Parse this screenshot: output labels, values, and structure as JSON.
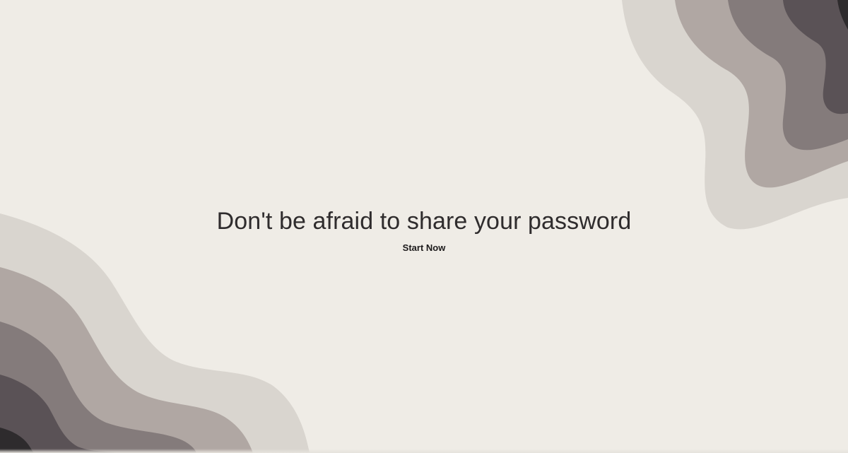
{
  "hero": {
    "headline": "Don't be afraid to share your password",
    "cta_label": "Start Now"
  },
  "colors": {
    "background": "#efece6",
    "wave_1": "#d9d5cf",
    "wave_2": "#b0a7a3",
    "wave_3": "#847b7b",
    "wave_4": "#5a5256",
    "wave_5": "#2e2b2d",
    "text": "#2f2c2d"
  }
}
